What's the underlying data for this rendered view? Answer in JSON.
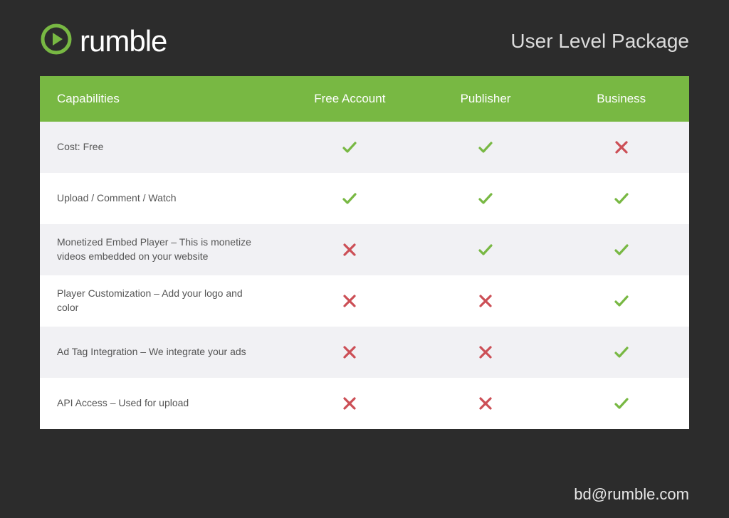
{
  "brand": {
    "name": "rumble"
  },
  "page_title": "User Level Package",
  "contact_email": "bd@rumble.com",
  "table": {
    "header": {
      "capabilities": "Capabilities",
      "tiers": [
        "Free Account",
        "Publisher",
        "Business"
      ]
    },
    "rows": [
      {
        "label": "Cost: Free",
        "values": [
          "check",
          "check",
          "cross"
        ]
      },
      {
        "label": "Upload / Comment / Watch",
        "values": [
          "check",
          "check",
          "check"
        ]
      },
      {
        "label": "Monetized Embed Player – This is monetize videos embedded on your website",
        "values": [
          "cross",
          "check",
          "check"
        ]
      },
      {
        "label": "Player Customization – Add your logo and color",
        "values": [
          "cross",
          "cross",
          "check"
        ]
      },
      {
        "label": "Ad Tag Integration – We integrate your ads",
        "values": [
          "cross",
          "cross",
          "check"
        ]
      },
      {
        "label": "API Access – Used for upload",
        "values": [
          "cross",
          "cross",
          "check"
        ]
      }
    ]
  },
  "colors": {
    "green": "#78b843",
    "check": "#78b843",
    "cross": "#cc4f56"
  }
}
